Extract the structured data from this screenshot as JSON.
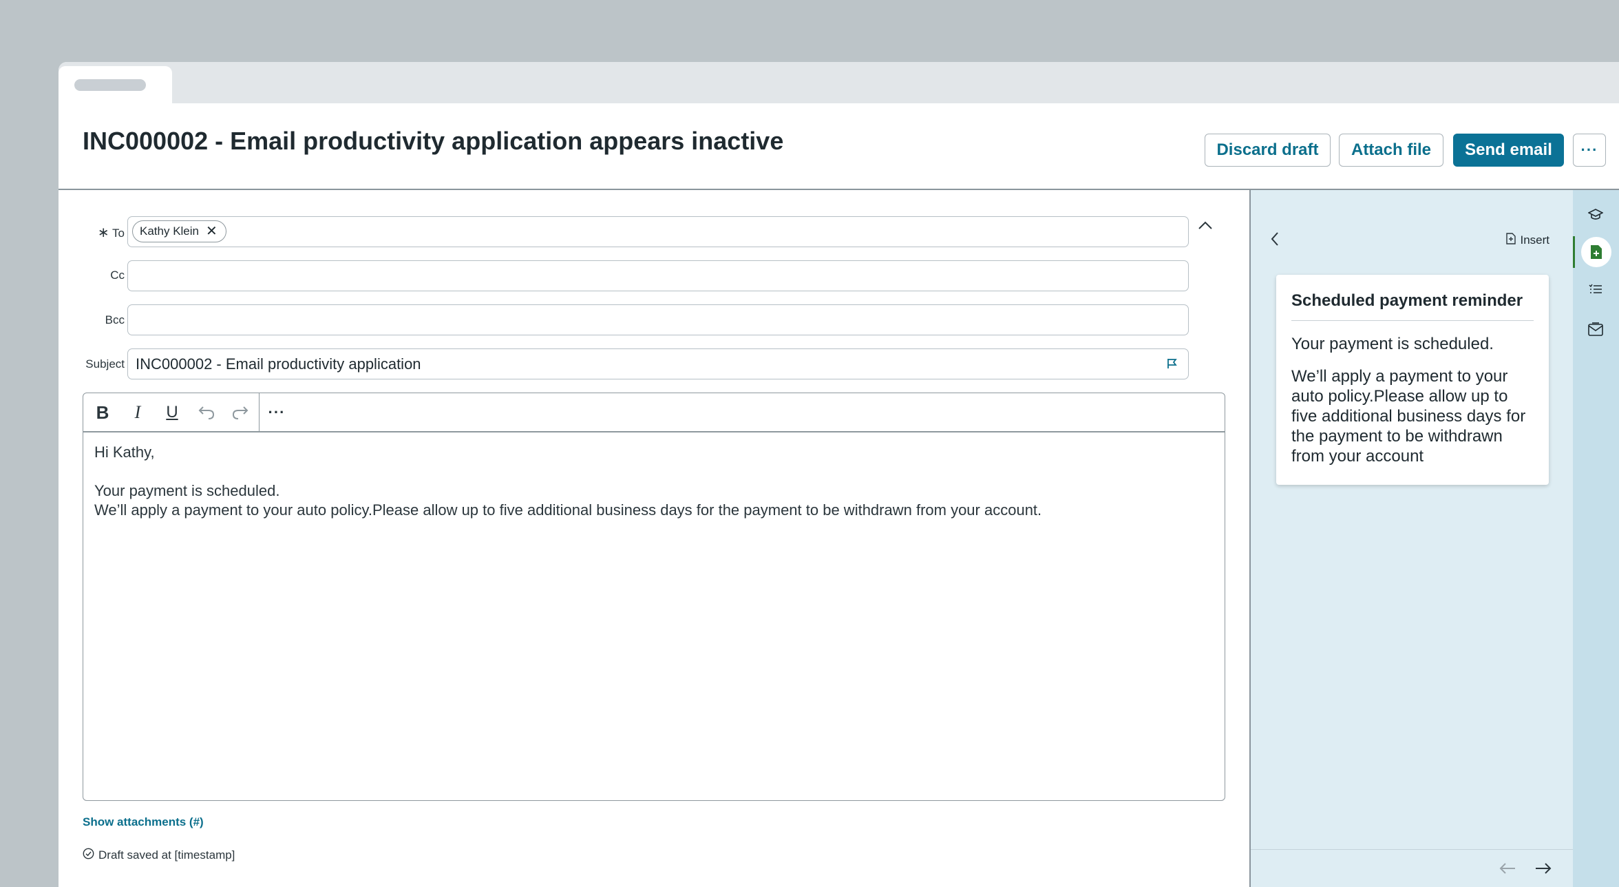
{
  "tab": {
    "label": ""
  },
  "header": {
    "title": "INC000002 - Email productivity application appears inactive",
    "discard_label": "Discard draft",
    "attach_label": "Attach file",
    "send_label": "Send email",
    "more_label": "···"
  },
  "compose": {
    "to_label": "To",
    "to_required": "∗",
    "to_recipients": [
      "Kathy Klein"
    ],
    "cc_label": "Cc",
    "cc_value": "",
    "bcc_label": "Bcc",
    "bcc_value": "",
    "subject_label": "Subject",
    "subject_value": "INC000002 - Email productivity application"
  },
  "editor": {
    "toolbar": [
      "bold",
      "italic",
      "underline",
      "undo",
      "redo",
      "more"
    ],
    "greeting": "Hi Kathy,",
    "line1": "Your payment is  scheduled.",
    "line2": "We’ll apply a payment to your auto policy.Please allow up to five additional business days for the payment to be withdrawn from your account."
  },
  "footer": {
    "show_attachments": "Show attachments (#)",
    "draft_saved": "Draft saved at [timestamp]"
  },
  "side_panel": {
    "insert_label": "Insert",
    "card": {
      "title": "Scheduled payment reminder",
      "line1": "Your payment is  scheduled.",
      "line2": "We’ll apply a payment to your auto policy.Please allow up to five additional business days for the payment to be withdrawn from your account"
    }
  },
  "icon_rail": [
    "graduation-cap-icon",
    "document-add-icon",
    "checklist-icon",
    "mail-template-icon"
  ],
  "colors": {
    "accent": "#0b7296",
    "panel_bg": "#deedf3",
    "rail_bg": "#c5dfea",
    "active_indicator": "#2e7d32"
  }
}
